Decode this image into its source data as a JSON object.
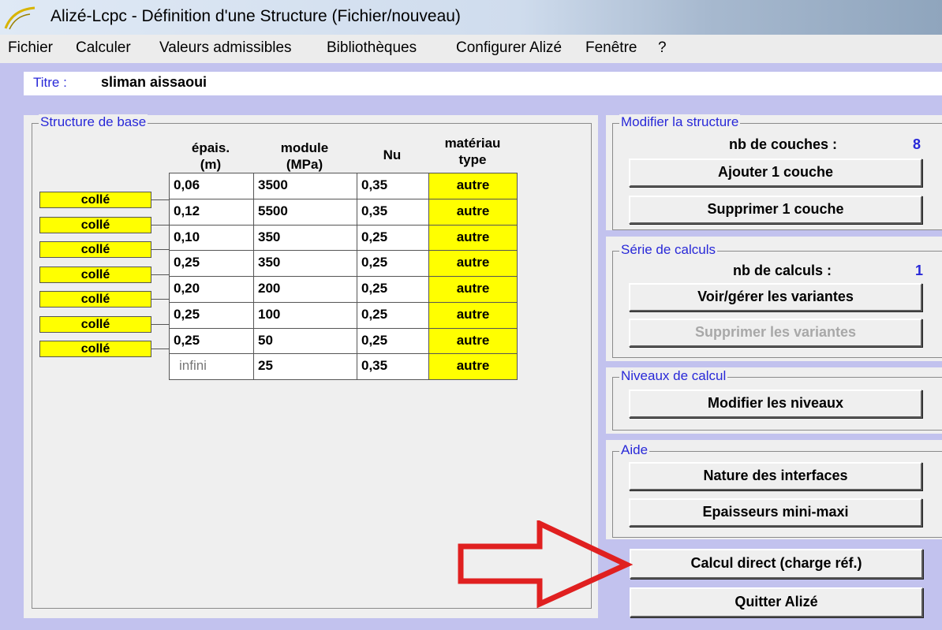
{
  "window": {
    "title": "Alizé-Lcpc - Définition d'une Structure (Fichier/nouveau)"
  },
  "menu": [
    "Fichier",
    "Calculer",
    "Valeurs admissibles",
    "Bibliothèques",
    "Configurer Alizé",
    "Fenêtre",
    "?"
  ],
  "titre": {
    "label": "Titre :",
    "value": "sliman aissaoui"
  },
  "structure": {
    "group_title": "Structure de base",
    "headers": {
      "epais_1": "épais.",
      "epais_2": "(m)",
      "module_1": "module",
      "module_2": "(MPa)",
      "nu": "Nu",
      "mat_1": "matériau",
      "mat_2": "type"
    },
    "layers": [
      {
        "epais": "0,06",
        "module": "3500",
        "nu": "0,35",
        "materiau": "autre"
      },
      {
        "epais": "0,12",
        "module": "5500",
        "nu": "0,35",
        "materiau": "autre"
      },
      {
        "epais": "0,10",
        "module": "350",
        "nu": "0,25",
        "materiau": "autre"
      },
      {
        "epais": "0,25",
        "module": "350",
        "nu": "0,25",
        "materiau": "autre"
      },
      {
        "epais": "0,20",
        "module": "200",
        "nu": "0,25",
        "materiau": "autre"
      },
      {
        "epais": "0,25",
        "module": "100",
        "nu": "0,25",
        "materiau": "autre"
      },
      {
        "epais": "0,25",
        "module": "50",
        "nu": "0,25",
        "materiau": "autre"
      },
      {
        "epais": "infini",
        "module": "25",
        "nu": "0,35",
        "materiau": "autre"
      }
    ],
    "interfaces": [
      "collé",
      "collé",
      "collé",
      "collé",
      "collé",
      "collé",
      "collé"
    ]
  },
  "modifier": {
    "group_title": "Modifier la structure",
    "count_label": "nb de couches :",
    "count_value": "8",
    "add_button": "Ajouter 1 couche",
    "remove_button": "Supprimer 1 couche"
  },
  "serie": {
    "group_title": "Série de calculs",
    "count_label": "nb de calculs :",
    "count_value": "1",
    "manage_button": "Voir/gérer les variantes",
    "delete_button": "Supprimer les variantes"
  },
  "niveaux": {
    "group_title": "Niveaux de calcul",
    "button": "Modifier les niveaux"
  },
  "aide": {
    "group_title": "Aide",
    "interfaces_button": "Nature des interfaces",
    "epaisseurs_button": "Epaisseurs mini-maxi"
  },
  "actions": {
    "calcul_direct": "Calcul direct (charge réf.)",
    "quitter": "Quitter Alizé"
  },
  "colors": {
    "accent_blue": "#2828d8",
    "client_bg": "#c2c2ee",
    "yellow": "#ffff00",
    "arrow_red": "#e02020"
  }
}
